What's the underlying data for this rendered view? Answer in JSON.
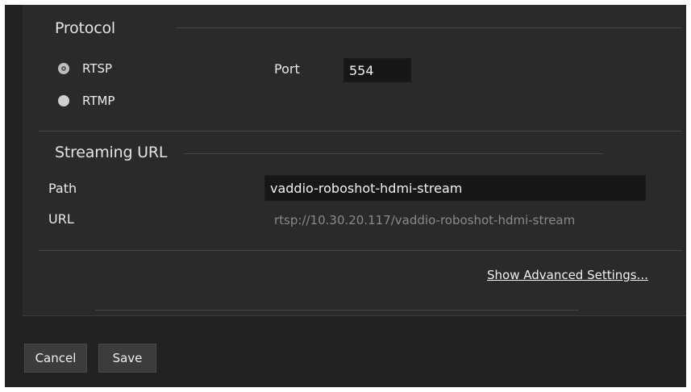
{
  "protocol": {
    "title": "Protocol",
    "options": [
      {
        "label": "RTSP",
        "selected": true
      },
      {
        "label": "RTMP",
        "selected": false
      }
    ],
    "port_label": "Port",
    "port_value": "554"
  },
  "streaming_url": {
    "title": "Streaming URL",
    "path_label": "Path",
    "path_value": "vaddio-roboshot-hdmi-stream",
    "url_label": "URL",
    "url_value": "rtsp://10.30.20.117/vaddio-roboshot-hdmi-stream"
  },
  "advanced_link": "Show Advanced Settings...",
  "footer": {
    "cancel_label": "Cancel",
    "save_label": "Save"
  },
  "colors": {
    "background": "#222222",
    "panel": "#2a2a2a",
    "input_bg": "#171717",
    "text": "#e8e8e8",
    "muted_text": "#8a8a8a"
  }
}
